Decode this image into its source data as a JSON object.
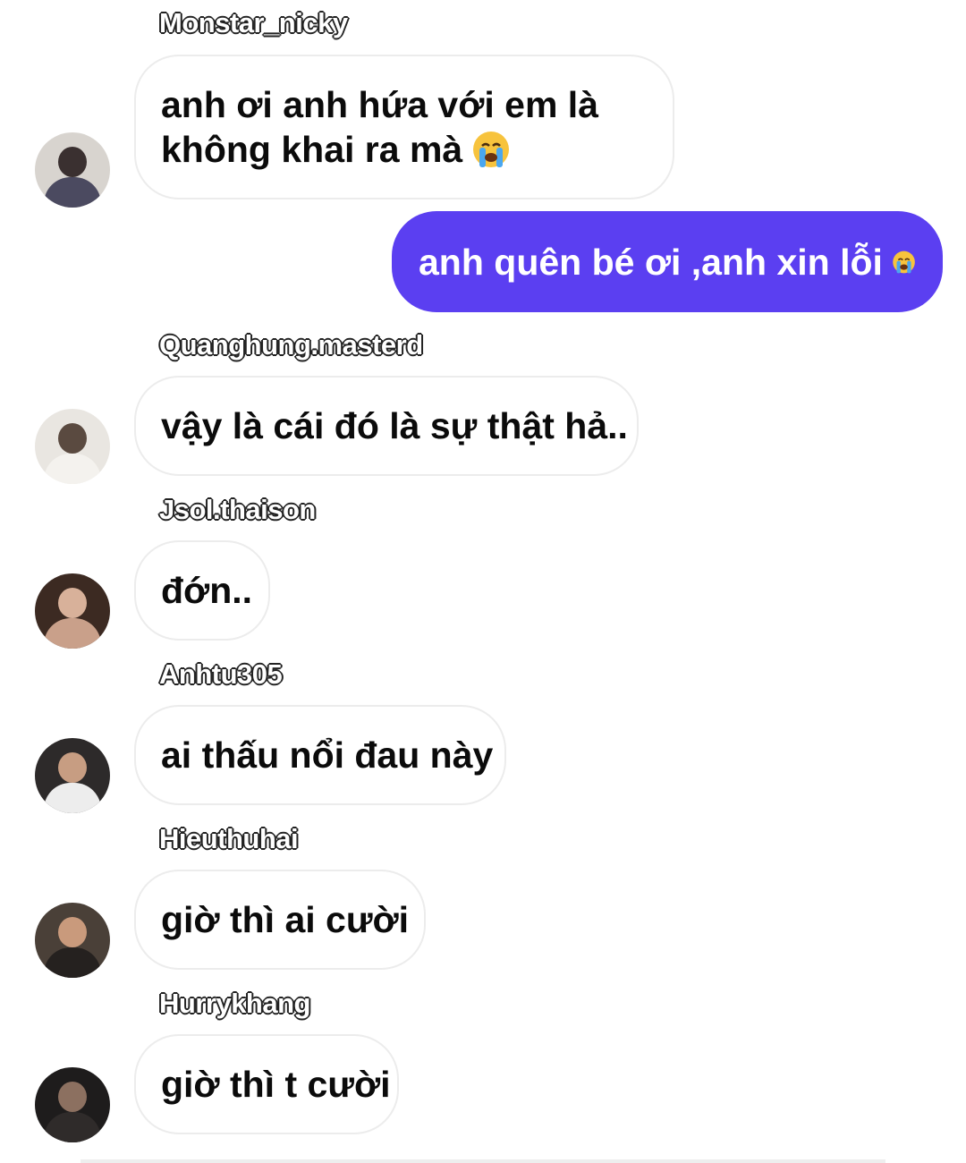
{
  "messages": [
    {
      "type": "incoming",
      "sender": "Monstar_nicky",
      "lines": [
        "anh ơi anh hứa với em là",
        "không khai ra mà"
      ],
      "emoji": "loudly-crying-face"
    },
    {
      "type": "outgoing",
      "text": "anh quên bé ơi ,anh xin lỗi",
      "emoji": "loudly-crying-face"
    },
    {
      "type": "incoming",
      "sender": "Quanghung.masterd",
      "text": "vậy là cái đó là sự thật hả.."
    },
    {
      "type": "incoming",
      "sender": "Jsol.thaison",
      "text": "đớn.."
    },
    {
      "type": "incoming",
      "sender": "Anhtu305",
      "text": "ai thấu nổi đau này"
    },
    {
      "type": "incoming",
      "sender": "Hieuthuhai",
      "text": "giờ thì ai cười"
    },
    {
      "type": "incoming",
      "sender": "Hurrykhang",
      "text": "giờ thì t cười"
    }
  ],
  "colors": {
    "outgoing_bubble": "#5b3ff1",
    "incoming_bubble": "#ffffff",
    "incoming_border": "#ececec",
    "sender_fill": "#ffffff",
    "sender_outline": "#222222"
  }
}
